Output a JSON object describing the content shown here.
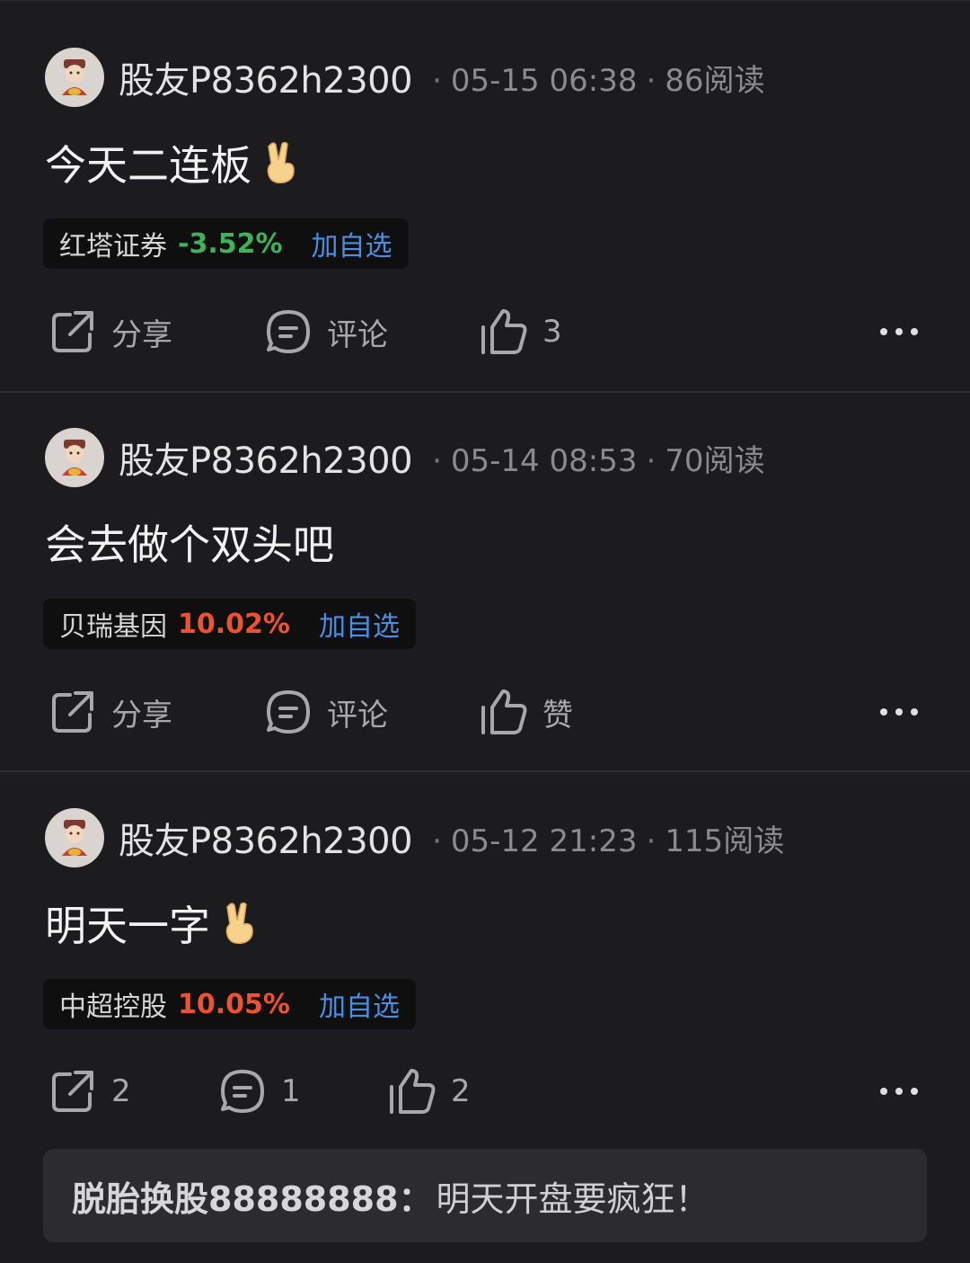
{
  "posts": [
    {
      "author": "股友P8362h2300",
      "time": "05-15 06:38",
      "reads": "86阅读",
      "content": "今天二连板",
      "emoji": "victory-hand",
      "stock": {
        "name": "红塔证券",
        "change": "-3.52%",
        "add_label": "加自选",
        "direction": "down"
      },
      "actions": {
        "share": "分享",
        "comment": "评论",
        "like": "3"
      }
    },
    {
      "author": "股友P8362h2300",
      "time": "05-14 08:53",
      "reads": "70阅读",
      "content": "会去做个双头吧",
      "emoji": "",
      "stock": {
        "name": "贝瑞基因",
        "change": "10.02%",
        "add_label": "加自选",
        "direction": "up"
      },
      "actions": {
        "share": "分享",
        "comment": "评论",
        "like": "赞"
      }
    },
    {
      "author": "股友P8362h2300",
      "time": "05-12 21:23",
      "reads": "115阅读",
      "content": "明天一字",
      "emoji": "victory-hand",
      "stock": {
        "name": "中超控股",
        "change": "10.05%",
        "add_label": "加自选",
        "direction": "up"
      },
      "actions": {
        "share": "2",
        "comment": "1",
        "like": "2"
      }
    }
  ],
  "separator": "·",
  "hot_comment": {
    "author": "脱胎换股88888888：",
    "text": "明天开盘要疯狂！"
  },
  "colors": {
    "background": "#1c1c1e",
    "down": "#3fb25b",
    "up": "#f0512e",
    "link": "#4b8fe2"
  }
}
